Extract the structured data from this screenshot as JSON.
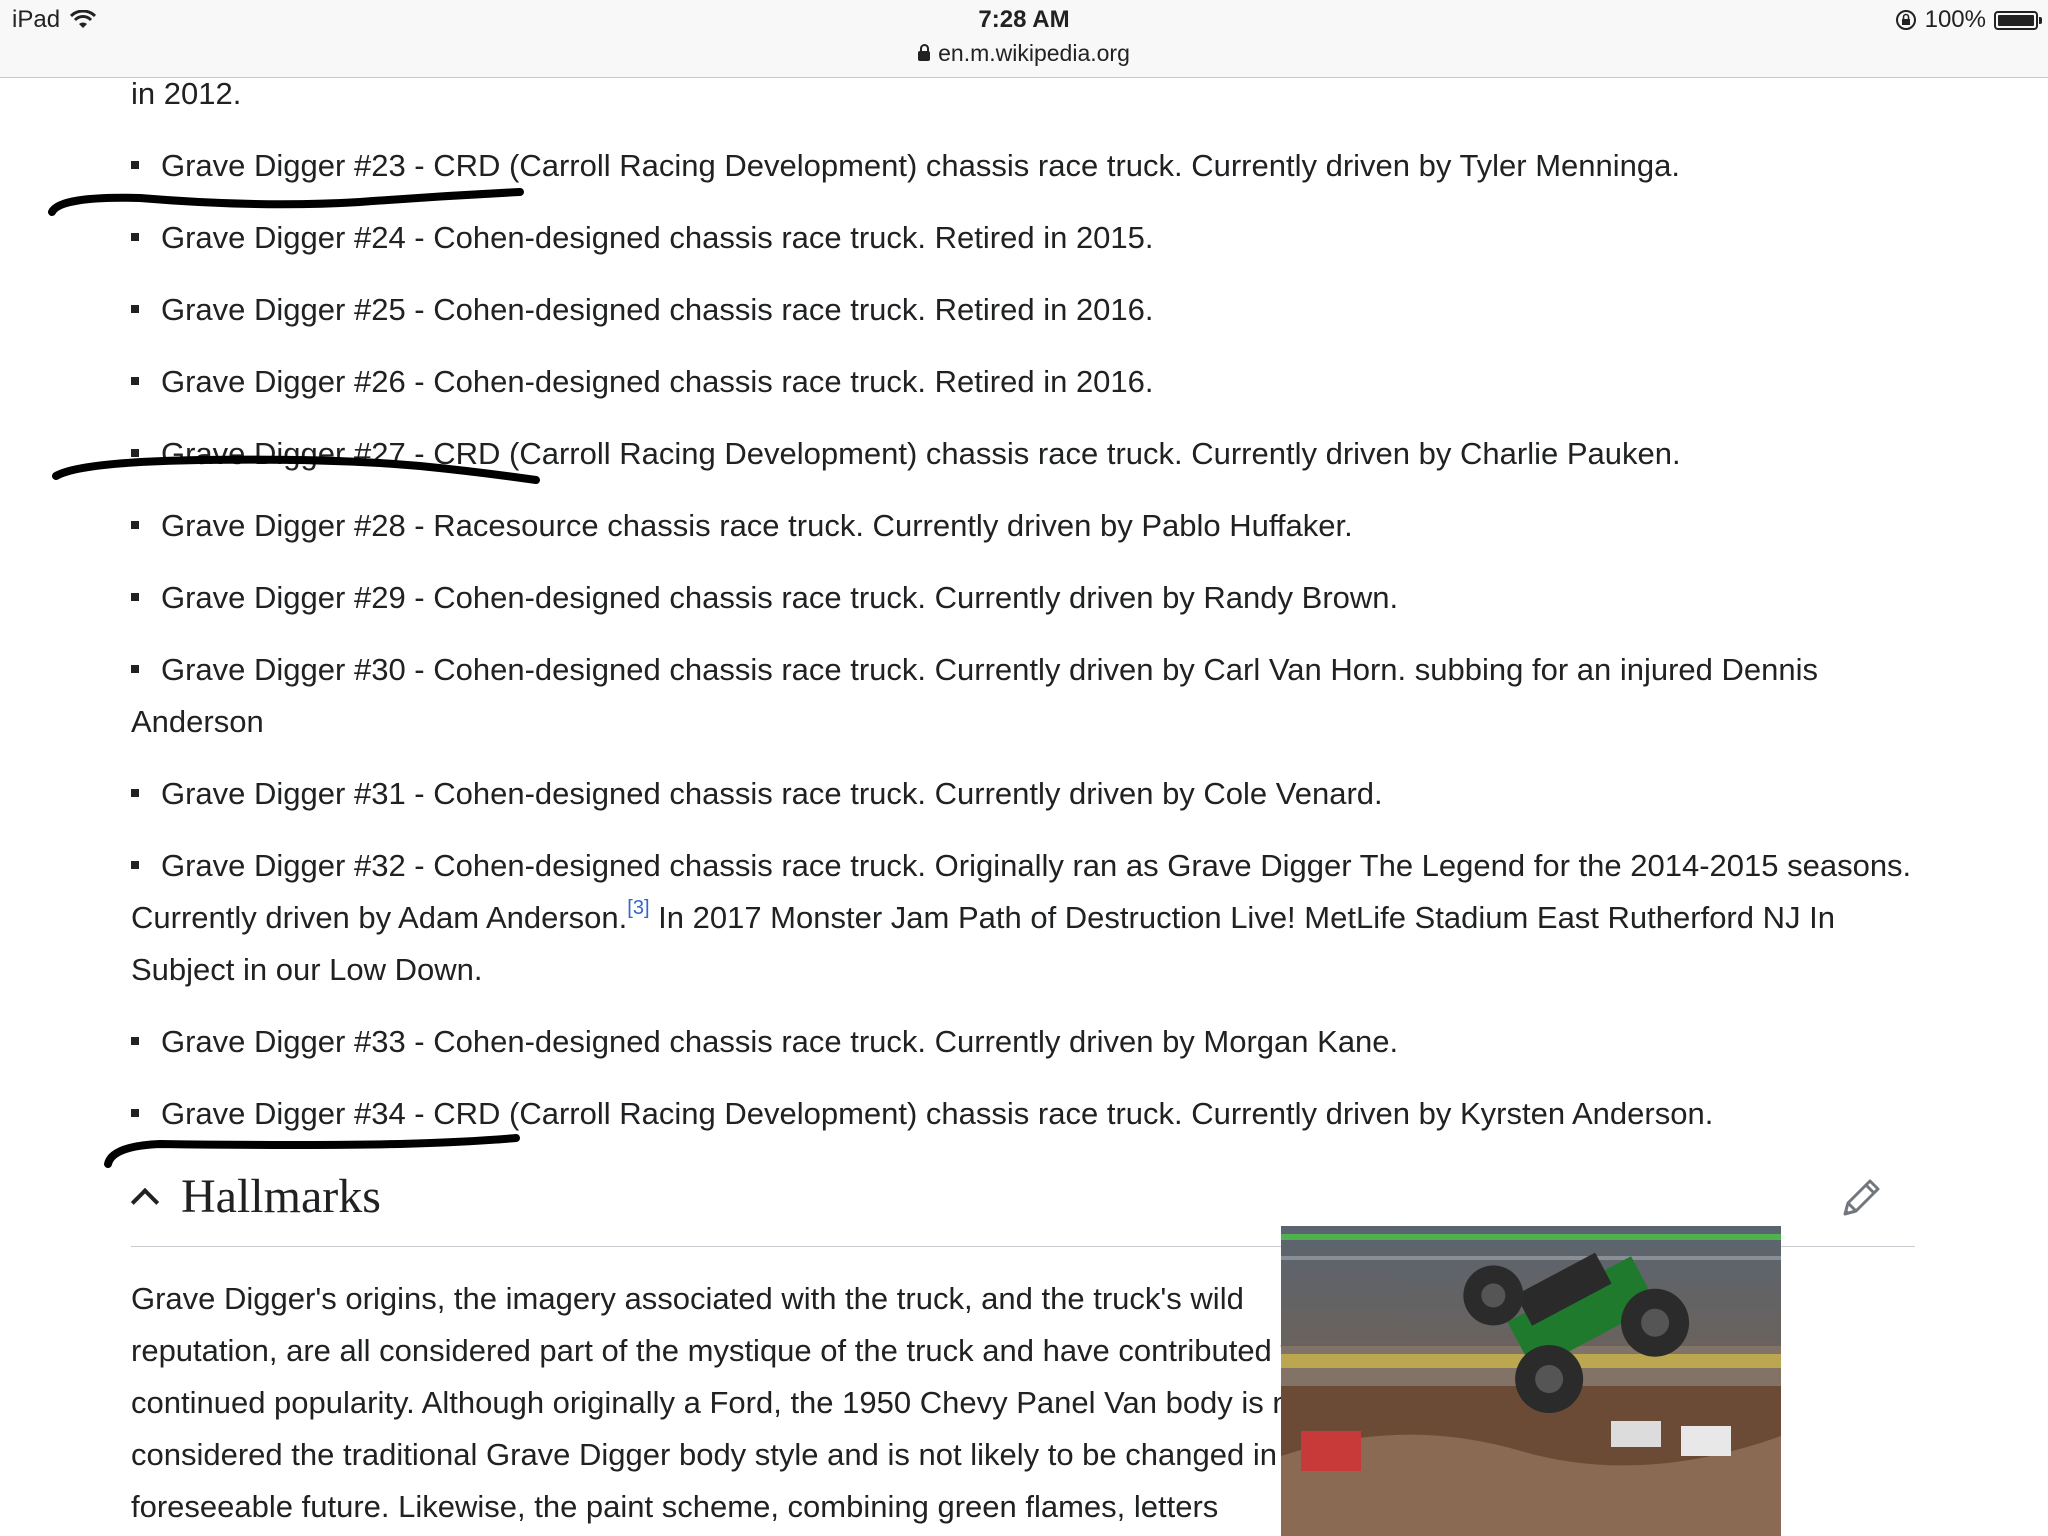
{
  "status_bar": {
    "device": "iPad",
    "time": "7:28 AM",
    "url": "en.m.wikipedia.org",
    "battery": "100%"
  },
  "article": {
    "prev_text": "in 2012.",
    "items": [
      "Grave Digger #23 - CRD (Carroll Racing Development) chassis race truck. Currently driven by Tyler Menninga.",
      "Grave Digger #24 - Cohen-designed chassis race truck. Retired in 2015.",
      "Grave Digger #25 - Cohen-designed chassis race truck. Retired in 2016.",
      "Grave Digger #26 - Cohen-designed chassis race truck. Retired in 2016.",
      "Grave Digger #27 - CRD (Carroll Racing Development) chassis race truck. Currently driven by Charlie Pauken.",
      "Grave Digger #28 - Racesource chassis race truck. Currently driven by Pablo Huffaker.",
      "Grave Digger #29 - Cohen-designed chassis race truck. Currently driven by Randy Brown.",
      "Grave Digger #30 - Cohen-designed chassis race truck. Currently driven by Carl Van Horn. subbing for an injured Dennis Anderson",
      "Grave Digger #31 - Cohen-designed chassis race truck. Currently driven by Cole Venard."
    ],
    "item32_a": "Grave Digger #32 - Cohen-designed chassis race truck. Originally ran as Grave Digger The Legend for the 2014-2015 seasons. Currently driven by Adam Anderson.",
    "item32_ref": "[3]",
    "item32_b": " In 2017 Monster Jam Path of Destruction Live! MetLife Stadium East Rutherford NJ In Subject in our Low Down.",
    "items_after": [
      "Grave Digger #33 - Cohen-designed chassis race truck. Currently driven by Morgan Kane.",
      "Grave Digger #34 - CRD (Carroll Racing Development) chassis race truck. Currently driven by Kyrsten Anderson."
    ],
    "section_title": "Hallmarks",
    "section_para": "Grave Digger's origins, the imagery associated with the truck, and the truck's wild reputation, are all considered part of the mystique of the truck and have contributed to its continued popularity. Although originally a Ford, the 1950 Chevy Panel Van body is now considered the traditional Grave Digger body style and is not likely to be changed in the foreseeable future. Likewise, the paint scheme, combining green flames, letters"
  },
  "icons": {
    "wifi": "wifi-icon",
    "lock": "lock-icon",
    "rotation_lock": "rotation-lock-icon",
    "battery": "battery-icon",
    "collapse": "chevron-up-icon",
    "edit": "pencil-icon"
  }
}
